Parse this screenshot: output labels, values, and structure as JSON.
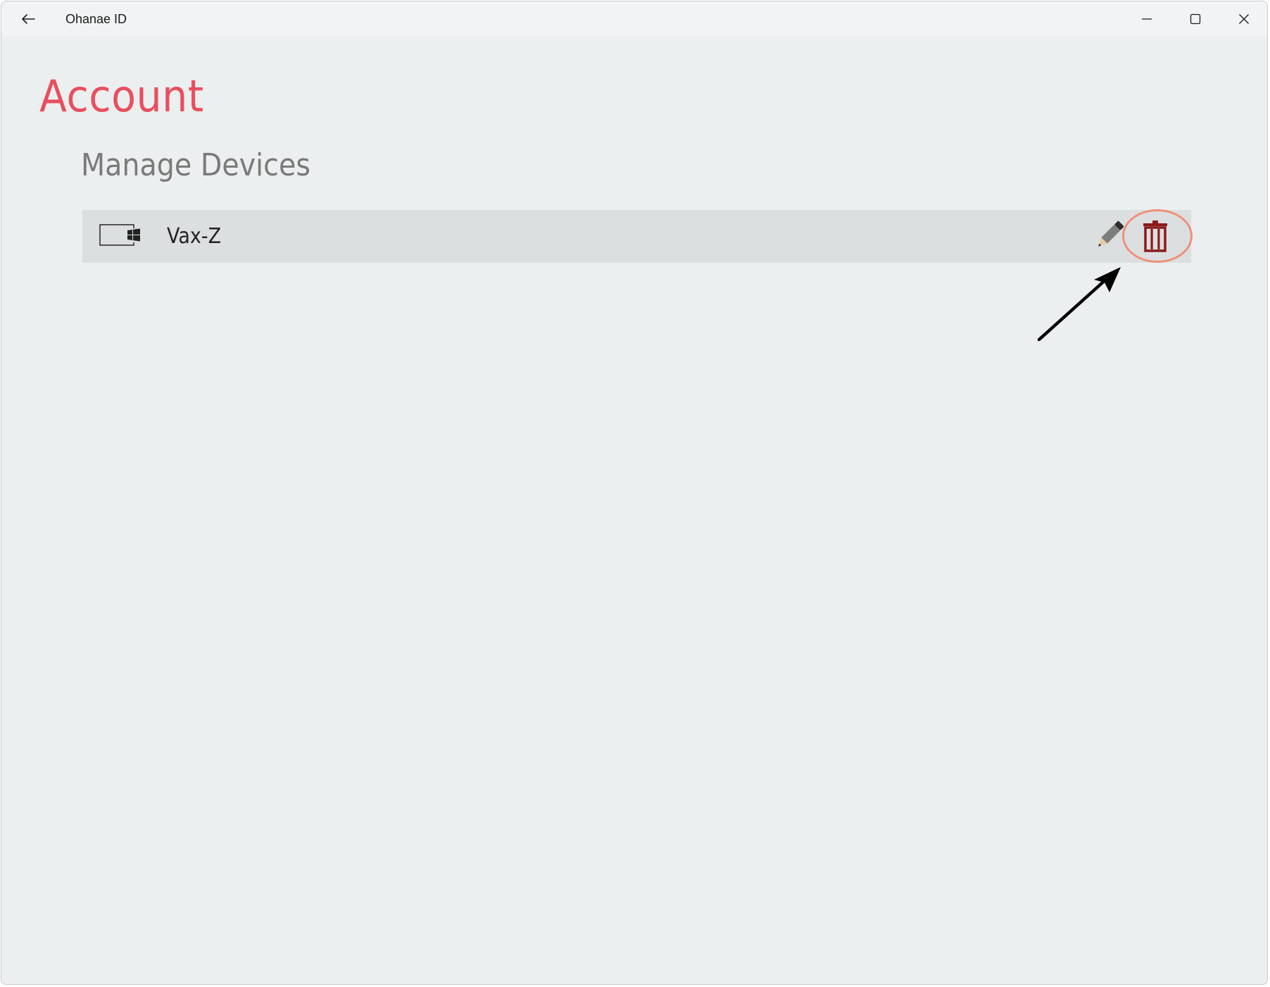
{
  "window": {
    "title": "Ohanae ID",
    "controls": {
      "minimize_icon": "minimize-icon",
      "maximize_icon": "maximize-icon",
      "close_icon": "close-icon"
    },
    "back_icon": "back-arrow-icon"
  },
  "page": {
    "title": "Account",
    "section_title": "Manage Devices"
  },
  "devices": [
    {
      "name": "Vax-Z",
      "icon": "windows-device-icon",
      "edit_icon": "pencil-icon",
      "delete_icon": "trash-icon"
    }
  ],
  "colors": {
    "accent": "#e84f5e",
    "delete": "#8b1a1a",
    "highlight": "#f0907a",
    "background": "#eceff0",
    "row_background": "#dcdfe0"
  }
}
